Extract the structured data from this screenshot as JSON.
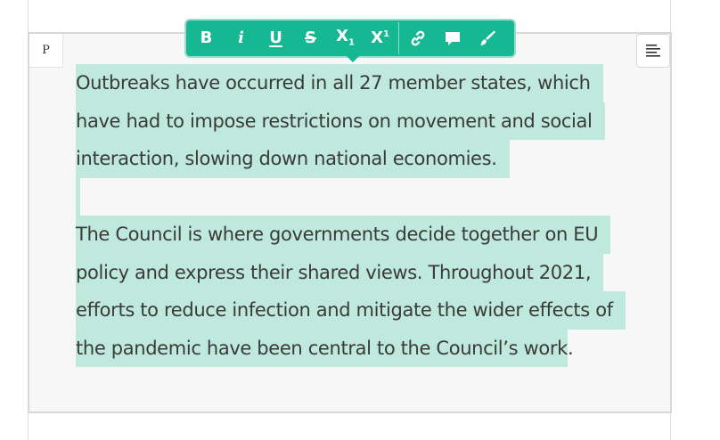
{
  "editor": {
    "block_type_badge": "P",
    "paragraphs": [
      {
        "lines": [
          "Outbreaks have occurred in all 27 member states, which",
          "have had to impose restrictions on movement and social",
          "interaction, slowing down national economies."
        ]
      },
      {
        "lines": [
          "The Council is where governments decide together on EU",
          "policy and express their shared views. Throughout 2021,",
          "efforts to reduce infection and mitigate the wider effects of",
          "the pandemic have been central to the Council’s work",
          "."
        ]
      }
    ]
  },
  "toolbar": {
    "buttons": [
      {
        "name": "bold",
        "icon": "bold-icon"
      },
      {
        "name": "italic",
        "icon": "italic-icon"
      },
      {
        "name": "underline",
        "icon": "underline-icon"
      },
      {
        "name": "strikethrough",
        "icon": "strikethrough-icon"
      },
      {
        "name": "subscript",
        "icon": "subscript-icon"
      },
      {
        "name": "superscript",
        "icon": "superscript-icon"
      },
      {
        "name": "link",
        "icon": "link-icon"
      },
      {
        "name": "comment",
        "icon": "comment-icon"
      },
      {
        "name": "highlight",
        "icon": "brush-icon"
      }
    ]
  },
  "colors": {
    "toolbar": "#16b894",
    "selection": "#bfe9dd",
    "text": "#3a3a3a",
    "block_background": "#f7f7f7"
  }
}
